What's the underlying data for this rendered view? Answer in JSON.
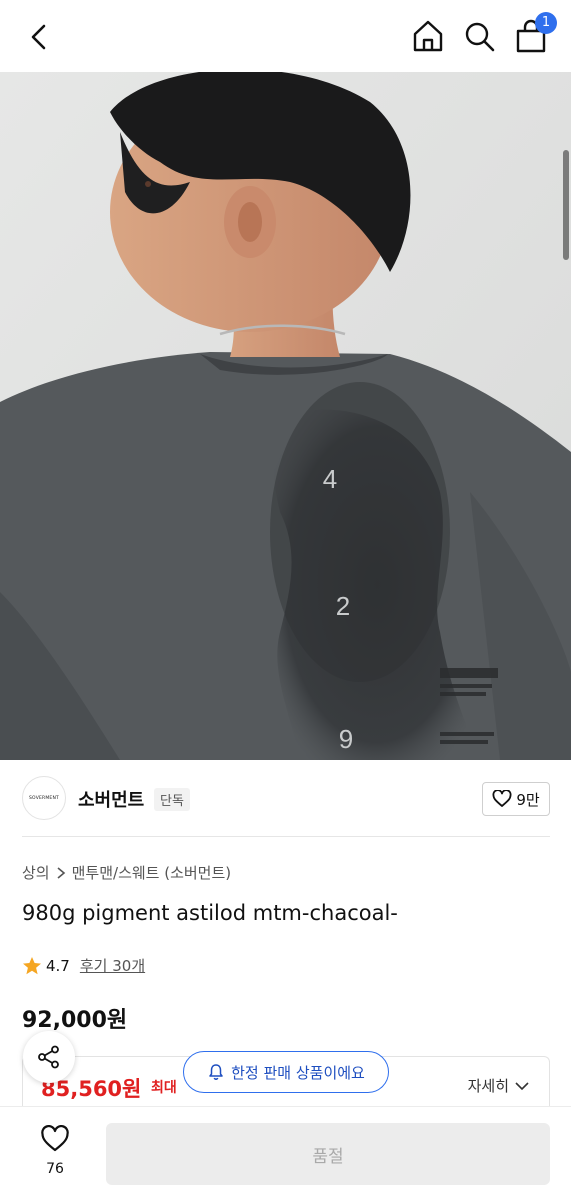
{
  "header": {
    "cart_count": "1",
    "icons": [
      "back-arrow-icon",
      "home-icon",
      "search-icon",
      "cart-icon"
    ]
  },
  "hero": {
    "back_numbers": [
      "4",
      "2",
      "9"
    ]
  },
  "brand": {
    "logo_text": "SOVERMENT",
    "name": "소버먼트",
    "tag": "단독",
    "likes": "9만"
  },
  "breadcrumb": {
    "level1": "상의",
    "level2": "맨투맨/스웨트 (소버먼트)"
  },
  "product": {
    "title": "980g pigment astilod mtm-chacoal-",
    "rating": "4.7",
    "review_label": "후기 30개",
    "price": "92,000원"
  },
  "sale": {
    "price": "85,560원",
    "max_label": "최대",
    "detail_label": "자세히"
  },
  "limited_notice": "한정 판매 상품이에요",
  "bottom": {
    "wish_count": "76",
    "soldout_label": "품절"
  },
  "colors": {
    "accent_blue": "#2f6fed",
    "sale_red": "#e02020",
    "star": "#f5a623"
  }
}
